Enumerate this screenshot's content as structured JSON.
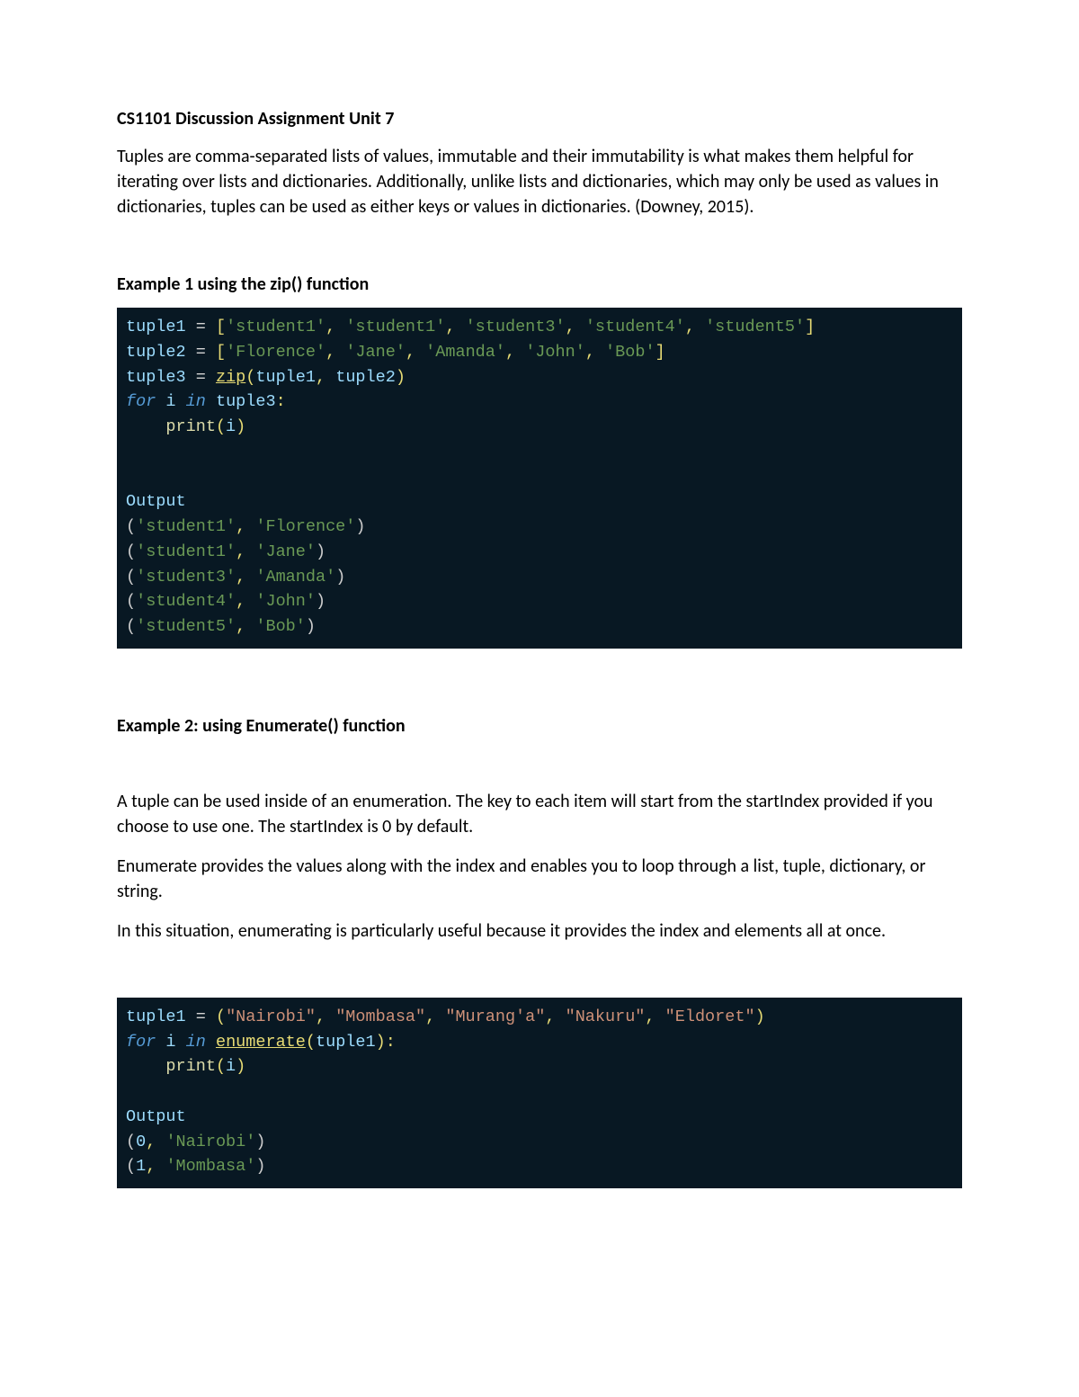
{
  "title": "CS1101 Discussion Assignment Unit 7",
  "intro_paragraph": "Tuples are comma-separated lists of values, immutable and their immutability is what makes them helpful for iterating over lists and dictionaries. Additionally, unlike lists and dictionaries, which may only be used as values in dictionaries, tuples can be used as either keys or values in dictionaries.   (Downey, 2015).",
  "example1": {
    "heading": "Example 1 using the zip() function",
    "code": {
      "line1": {
        "var": "tuple1",
        "vals": [
          "'student1'",
          "'student1'",
          "'student3'",
          "'student4'",
          "'student5'"
        ]
      },
      "line2": {
        "var": "tuple2",
        "vals": [
          "'Florence'",
          "'Jane'",
          "'Amanda'",
          "'John'",
          "'Bob'"
        ]
      },
      "line3": {
        "var": "tuple3",
        "func": "zip",
        "args": [
          "tuple1",
          "tuple2"
        ]
      },
      "line4": {
        "kw_for": "for",
        "loopvar": "i",
        "kw_in": "in",
        "iter": "tuple3"
      },
      "line5": {
        "func": "print",
        "arg": "i"
      },
      "output_label": "Output",
      "output_lines": [
        {
          "a": "'student1'",
          "b": "'Florence'"
        },
        {
          "a": "'student1'",
          "b": "'Jane'"
        },
        {
          "a": "'student3'",
          "b": "'Amanda'"
        },
        {
          "a": "'student4'",
          "b": "'John'"
        },
        {
          "a": "'student5'",
          "b": "'Bob'"
        }
      ]
    }
  },
  "example2": {
    "heading": "Example 2: using Enumerate() function",
    "para1": "A tuple can be used inside of an enumeration. The key to each item will start from the startIndex provided if you choose to use one. The startIndex is 0 by default.",
    "para2": "Enumerate provides the values along with the index and enables you to loop through a list, tuple, dictionary, or string.",
    "para3": "In this situation, enumerating is particularly useful because it provides the index and elements all at once.",
    "code": {
      "line1": {
        "var": "tuple1",
        "vals": [
          "\"Nairobi\"",
          "\"Mombasa\"",
          "\"Murang'a\"",
          "\"Nakuru\"",
          "\"Eldoret\""
        ]
      },
      "line2": {
        "kw_for": "for",
        "loopvar": "i",
        "kw_in": "in",
        "func": "enumerate",
        "arg": "tuple1"
      },
      "line3": {
        "func": "print",
        "arg": "i"
      },
      "output_label": "Output",
      "output_lines": [
        {
          "idx": "0",
          "val": "'Nairobi'"
        },
        {
          "idx": "1",
          "val": "'Mombasa'"
        }
      ]
    }
  }
}
